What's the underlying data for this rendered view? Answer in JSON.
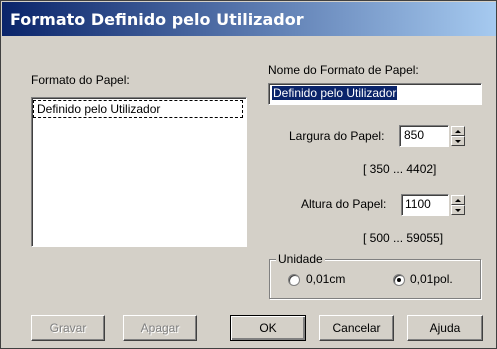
{
  "window": {
    "title": "Formato Definido pelo Utilizador"
  },
  "paper_format": {
    "label": "Formato do Papel:",
    "items": [
      "Definido pelo Utilizador"
    ]
  },
  "paper_format_name": {
    "label": "Nome do Formato de Papel:",
    "value": "Definido pelo Utilizador"
  },
  "width": {
    "label": "Largura do Papel:",
    "value": "850",
    "range": "[  350 ...  4402]"
  },
  "height": {
    "label": "Altura do Papel:",
    "value": "1100",
    "range": "[  500 ... 59055]"
  },
  "unit": {
    "label": "Unidade",
    "options": [
      "0,01cm",
      "0,01pol."
    ],
    "selected": "0,01pol."
  },
  "buttons": {
    "save": "Gravar",
    "delete": "Apagar",
    "ok": "OK",
    "cancel": "Cancelar",
    "help": "Ajuda"
  }
}
